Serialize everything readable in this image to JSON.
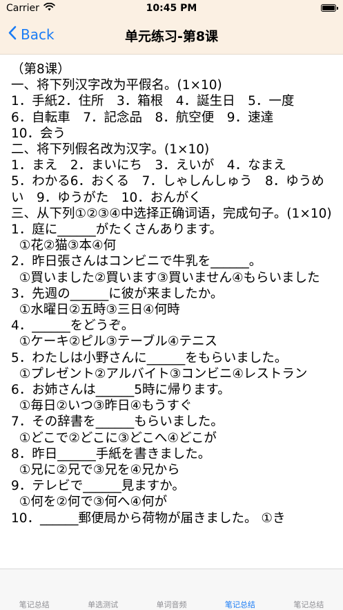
{
  "status": {
    "carrier": "Carrier",
    "time": "10:45 PM",
    "battery_level": 1.0
  },
  "nav": {
    "back_label": "Back",
    "title": "单元练习-第8课"
  },
  "content": {
    "lines": [
      "（第8课）",
      "一、将下列汉字改为平假名。(1×10)",
      "1．手紙2．住所　3．箱根　4．誕生日　5．一度",
      "6．自転車　7．記念品　8．航空便　9．速達",
      "10．会う",
      "二、将下列假名改为汉字。(1×10)",
      "1．まえ　2．まいにち　3．えいが　4．なまえ",
      "5．わかる6．おくる　7．しゃしんしゅう　8．ゆうめい　9．ゆうがた　10．おんがく",
      "三、从下列①②③④中选择正确词语，完成句子。(1×10)",
      "1．庭に______がたくさんあります。",
      "  ①花②猫③本④何",
      "2．昨日張さんはコンビニで牛乳を______。",
      "  ①買いました②買います③買いません④もらいました",
      "3．先週の______に彼が来ましたか。",
      "  ①水曜日②五時③三日④何時",
      "4．______をどうぞ。",
      "  ①ケーキ②ピル③テーブル④テニス",
      "5．わたしは小野さんに______をもらいました。",
      "  ①プレゼント②アルバイト③コンビニ④レストラン",
      "6．お姉さんは______5時に帰ります。",
      "  ①毎日②いつ③昨日④もうすぐ",
      "7．その辞書を______もらいました。",
      "  ①どこで②どこに③どこへ④どこが",
      "8．昨日______手紙を書きました。",
      "  ①兄に②兄で③兄を④兄から",
      "9．テレビで______見ますか。",
      "  ①何を②何で③何へ④何が",
      "10．______郵便局から荷物が届きました。 ①き"
    ]
  },
  "tabbar": {
    "active_index": 3,
    "active_color": "#1a7cf5",
    "inactive_color": "#8e8e93",
    "tabs": [
      {
        "label": "笔记总结"
      },
      {
        "label": "单选测试"
      },
      {
        "label": "单词音频"
      },
      {
        "label": "笔记总结"
      },
      {
        "label": "笔记总结"
      }
    ]
  },
  "colors": {
    "accent": "#1a7cf5",
    "nav_background": "#fbf0e3"
  }
}
